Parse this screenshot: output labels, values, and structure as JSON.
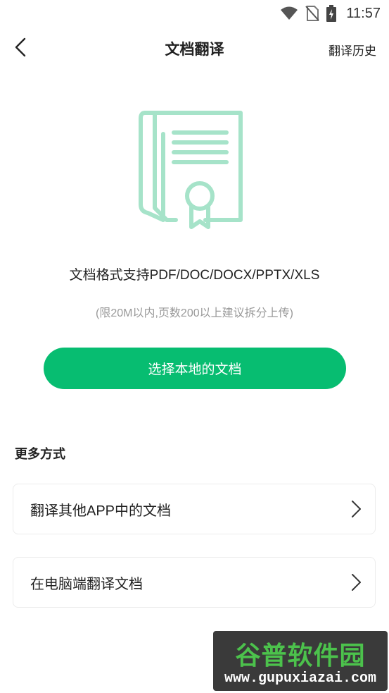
{
  "status_bar": {
    "time": "11:57",
    "icons": [
      "wifi-icon",
      "no-sim-icon",
      "battery-charging-icon"
    ]
  },
  "header": {
    "back_icon": "chevron-left-icon",
    "title": "文档翻译",
    "history_label": "翻译历史"
  },
  "hero": {
    "icon": "document-certificate-icon",
    "accent_color": "#a6e3c9"
  },
  "info": {
    "formats": "文档格式支持PDF/DOC/DOCX/PPTX/XLS",
    "limit": "(限20M以内,页数200以上建议拆分上传)"
  },
  "primary_button": {
    "label": "选择本地的文档",
    "color": "#07bd71"
  },
  "more": {
    "title": "更多方式",
    "options": [
      {
        "label": "翻译其他APP中的文档",
        "icon": "chevron-right-icon"
      },
      {
        "label": "在电脑端翻译文档",
        "icon": "chevron-right-icon"
      }
    ]
  },
  "watermark": {
    "title": "谷普软件园",
    "url": "www.gupuxiazai.com"
  }
}
